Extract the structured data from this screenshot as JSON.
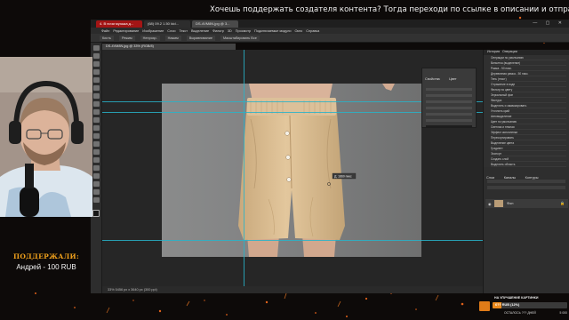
{
  "ticker": "Хочешь поддержать создателя контента? Тогда переходи по ссылке в описании и отправляй донат",
  "browser": {
    "tabs": [
      {
        "label": "4. В ночи музыка д..."
      },
      {
        "label": "(68) 09.2 1.50 Idd..."
      },
      {
        "label": "DS-4VM8N.jpg @ 3..."
      }
    ],
    "controls": "—  ▢  ✕"
  },
  "photoshop": {
    "menu": [
      "Файл",
      "Редактирование",
      "Изображение",
      "Слои",
      "Текст",
      "Выделение",
      "Фильтр",
      "3D",
      "Просмотр",
      "Подключаемые модули",
      "Окно",
      "Справка"
    ],
    "options": [
      "Кисть",
      "Режим",
      "Непрозр.",
      "Нажим",
      "Выравнивание",
      "Масштабировать Все"
    ],
    "document_tab": "DS-4VM8N.jpg @ 33% (RGB/8)",
    "status": "33%   5456 px x 3640 px (300 ppi)",
    "properties": {
      "tabs": [
        "Свойства",
        "Цвет"
      ]
    },
    "history": {
      "tabs": [
        "История",
        "Операции"
      ],
      "items": [
        "Операции по умолчанию",
        "Виньетка (выделение)",
        "Рамка - 50 пикс.",
        "Деревянная рамка - 50 пикс.",
        "Тень (текст)",
        "Отражение в воде",
        "Фильтр по цвету",
        "Зеркальный фон",
        "Фактура",
        "Выделить и замаскировать",
        "Уточнить край",
        "Автовыделение",
        "Цвет по умолчанию",
        "Светлая и темная",
        "Эффект кинопленки",
        "Пересортировать",
        "Выделение цвета",
        "Градиент",
        "Экспорт",
        "Создать слой",
        "Выделить область",
        "Заливка",
        "Выделить слой 1"
      ]
    },
    "layers": {
      "tabs": [
        "Слои",
        "Каналы",
        "Контуры"
      ],
      "rows": [
        "Фон"
      ]
    }
  },
  "donation": {
    "title": "ПОДДЕРЖАЛИ:",
    "text": "Андрей - 100 RUB"
  },
  "goal": {
    "title": "НА УЛУЧШЕНИЕ КАРТИНКИ",
    "amount": "6?? RUB (12%)",
    "progress": 0.12,
    "subtitle": "ОСТАЛОСЬ ??? ДНЕЙ",
    "end": "5 000"
  },
  "colors": {
    "accent": "#e9881b",
    "guide": "#28b3c9",
    "donation_title": "#f0a11c",
    "short_fabric": "#d7b98f"
  }
}
